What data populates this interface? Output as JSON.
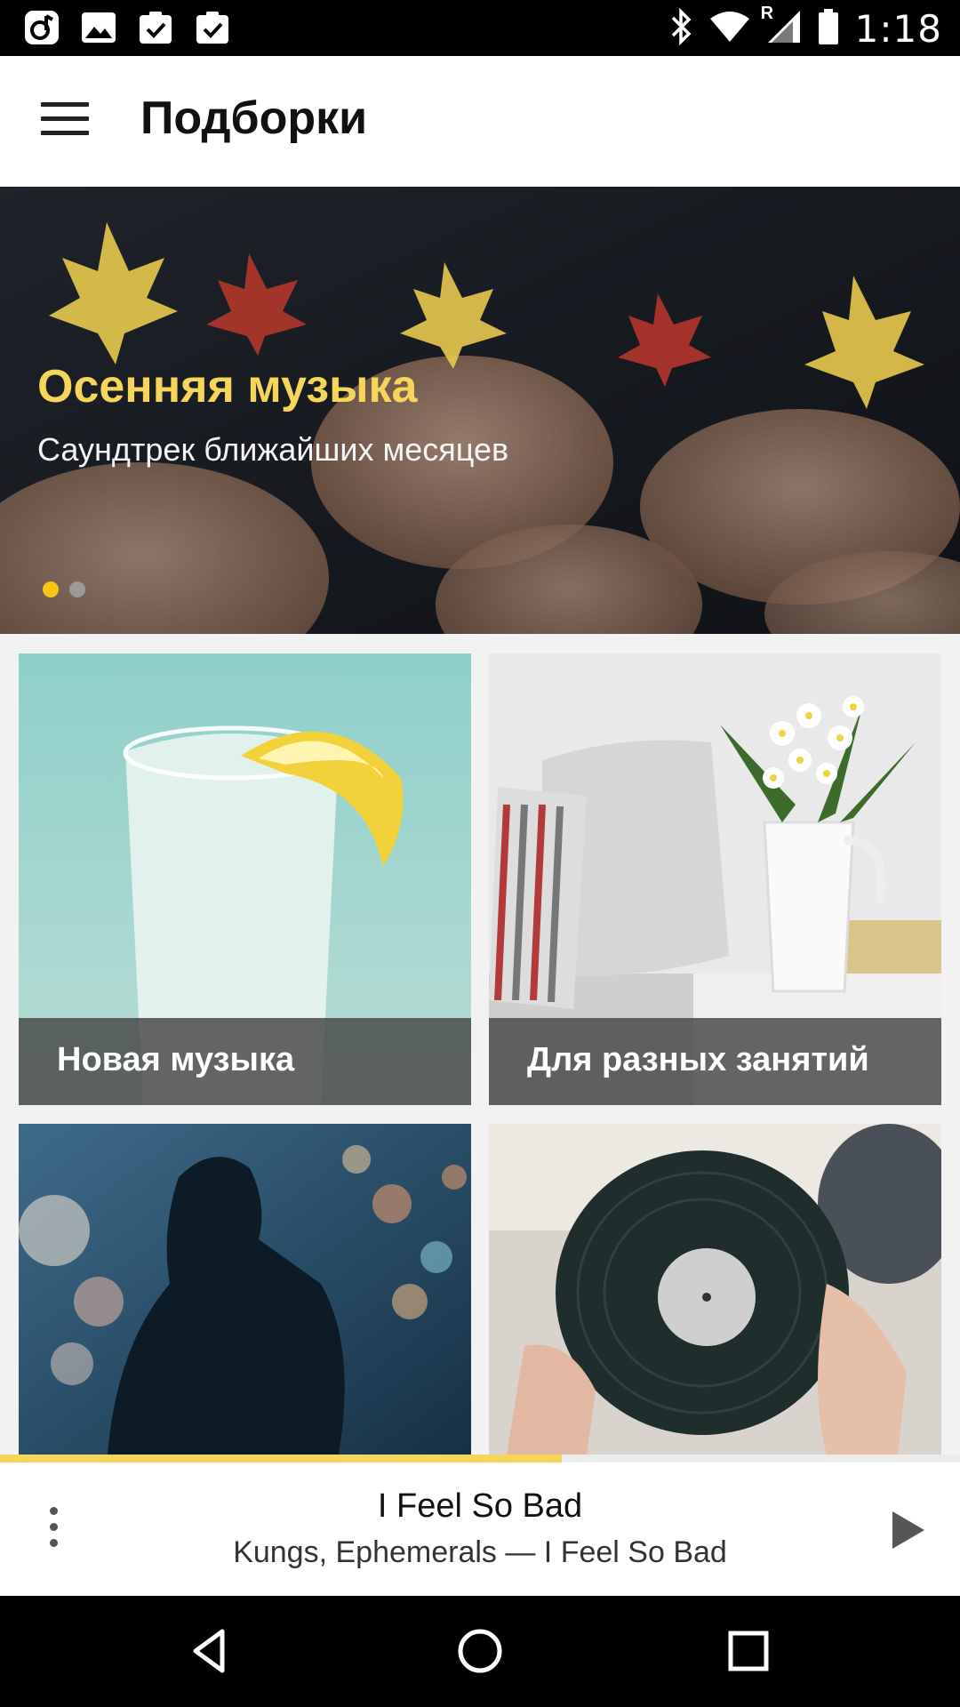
{
  "status_bar": {
    "time": "1:18",
    "left_icons": [
      "music-app-icon",
      "image-icon",
      "task-check-icon",
      "task-check-icon"
    ],
    "right_icons": [
      "bluetooth-icon",
      "wifi-icon",
      "signal-roaming-icon",
      "battery-icon"
    ],
    "roaming_indicator": "R"
  },
  "app_bar": {
    "title": "Подборки",
    "menu_icon": "hamburger-menu-icon"
  },
  "hero": {
    "title": "Осенняя музыка",
    "subtitle": "Саундтрек ближайших месяцев",
    "pager": {
      "pages": 2,
      "active": 1
    },
    "image": "hands holding autumn maple leaves"
  },
  "tiles": [
    {
      "label": "Новая музыка",
      "image": "glass of lemonade with lemon slice"
    },
    {
      "label": "Для разных занятий",
      "image": "sofa with pillows and vase of daisies"
    },
    {
      "label": "",
      "image": "silhouette of guitarist with bokeh lights"
    },
    {
      "label": "",
      "image": "hands holding vinyl record"
    }
  ],
  "player": {
    "progress": 0.585,
    "track_title": "I Feel So Bad",
    "track_subtitle": "Kungs, Ephemerals — I Feel So Bad",
    "more_icon": "more-vertical-icon",
    "play_icon": "play-icon"
  },
  "nav_bar": {
    "buttons": [
      "back-icon",
      "home-icon",
      "recents-icon"
    ]
  },
  "colors": {
    "accent": "#f5d55a",
    "pager_active": "#f5c518",
    "status_bar": "#000000",
    "nav_bar": "#000000"
  }
}
